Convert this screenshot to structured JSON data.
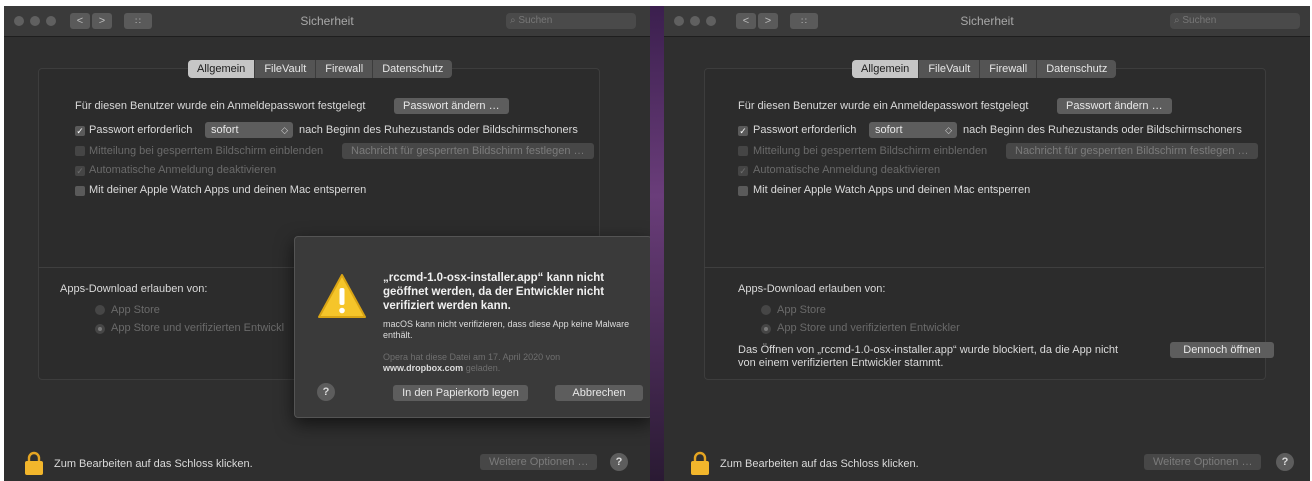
{
  "window": {
    "title": "Sicherheit",
    "search_placeholder": "Suchen",
    "nav_back": "<",
    "nav_forward": ">",
    "grid": "∷"
  },
  "tabs": [
    "Allgemein",
    "FileVault",
    "Firewall",
    "Datenschutz"
  ],
  "general": {
    "password_set_text": "Für diesen Benutzer wurde ein Anmeldepasswort festgelegt",
    "change_password_button": "Passwort ändern …",
    "require_password_label": "Passwort erforderlich",
    "require_password_value": "sofort",
    "require_password_suffix": "nach Beginn des Ruhezustands oder Bildschirmschoners",
    "lock_message_label": "Mitteilung bei gesperrtem Bildschirm einblenden",
    "lock_message_button": "Nachricht für gesperrten Bildschirm festlegen …",
    "auto_login_label": "Automatische Anmeldung deaktivieren",
    "apple_watch_label": "Mit deiner Apple Watch Apps und deinen Mac entsperren",
    "checkmark": "✓",
    "select_arrow": "◇"
  },
  "apps_download": {
    "heading": "Apps-Download erlauben von:",
    "option_store": "App Store",
    "option_store_devs": "App Store und verifizierten Entwickler",
    "option_store_devs_cut": "App Store und verifizierten Entwickl",
    "blocked_text_line1": "Das Öffnen von „rccmd-1.0-osx-installer.app“ wurde blockiert, da die App nicht",
    "blocked_text_line2": "von einem verifizierten Entwickler stammt.",
    "open_anyway_button": "Dennoch öffnen"
  },
  "footer": {
    "lock_text": "Zum Bearbeiten auf das Schloss klicken.",
    "more_options_button": "Weitere Optionen …",
    "help": "?"
  },
  "dialog": {
    "title": "„rccmd-1.0-osx-installer.app“ kann nicht geöffnet werden, da der Entwickler nicht verifiziert werden kann.",
    "body": "macOS kann nicht verifizieren, dass diese App keine Malware enthält.",
    "note_prefix": "Opera hat diese Datei am 17. April 2020 von",
    "note_source": "www.dropbox.com",
    "note_suffix": "geladen.",
    "trash_button": "In den Papierkorb legen",
    "cancel_button": "Abbrechen",
    "help": "?"
  }
}
